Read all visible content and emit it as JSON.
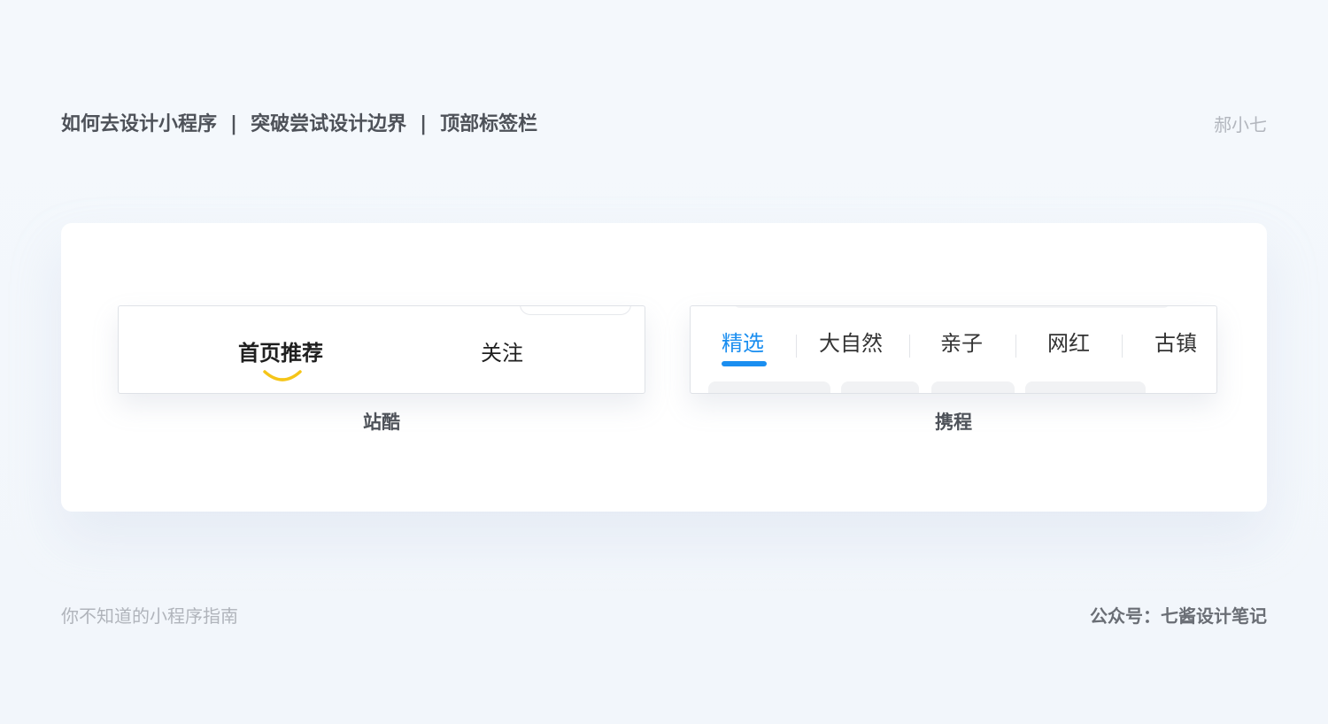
{
  "header": {
    "title_parts": [
      "如何去设计小程序",
      "突破尝试设计边界",
      "顶部标签栏"
    ],
    "separator": "|",
    "author": "郝小七"
  },
  "examples": {
    "left": {
      "label": "站酷",
      "tabs": [
        "首页推荐",
        "关注"
      ],
      "active_tab": "首页推荐",
      "indicator_color": "#f5c518"
    },
    "right": {
      "label": "携程",
      "tabs": [
        "精选",
        "大自然",
        "亲子",
        "网红",
        "古镇"
      ],
      "active_tab": "精选",
      "active_color": "#1a8ef0"
    }
  },
  "footer": {
    "left_text": "你不知道的小程序指南",
    "right_text": "公众号：七酱设计笔记"
  }
}
